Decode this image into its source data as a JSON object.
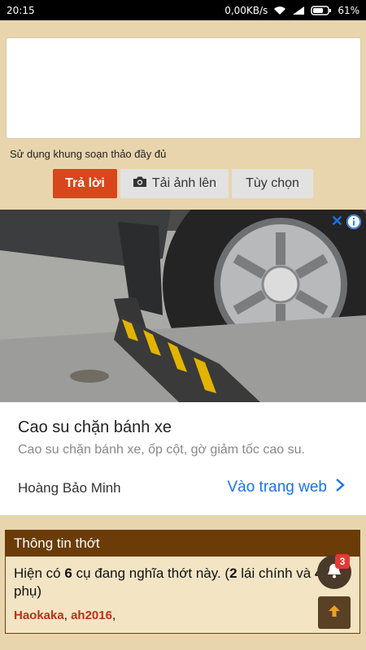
{
  "status_bar": {
    "time": "20:15",
    "network_speed": "0,00KB/s",
    "battery_percent": "61%"
  },
  "reply": {
    "full_editor_label": "Sử dụng khung soạn thảo đầy đủ",
    "reply_button": "Trả lời",
    "upload_button": "Tải ảnh lên",
    "options_button": "Tùy chọn"
  },
  "ad": {
    "title": "Cao su chặn bánh xe",
    "description": "Cao su chặn bánh xe, ốp cột, gờ giảm tốc cao su.",
    "advertiser": "Hoàng Bảo Minh",
    "cta": "Vào trang web"
  },
  "thread_info": {
    "header": "Thông tin thớt",
    "text_prefix": "Hiện có ",
    "viewer_count": "6",
    "text_middle": " cụ đang nghĩa thớt này. (",
    "main_count": "2",
    "text_main": " lái chính và ",
    "sub_count": "4",
    "text_sub": " phụ)",
    "users": [
      "Haokaka",
      "ah2016"
    ]
  },
  "notifications": {
    "badge": "3"
  },
  "colors": {
    "page_bg": "#e9d5ad",
    "reply_button": "#d8461c",
    "section_header": "#6b3c08",
    "link_blue": "#1a73e8"
  }
}
